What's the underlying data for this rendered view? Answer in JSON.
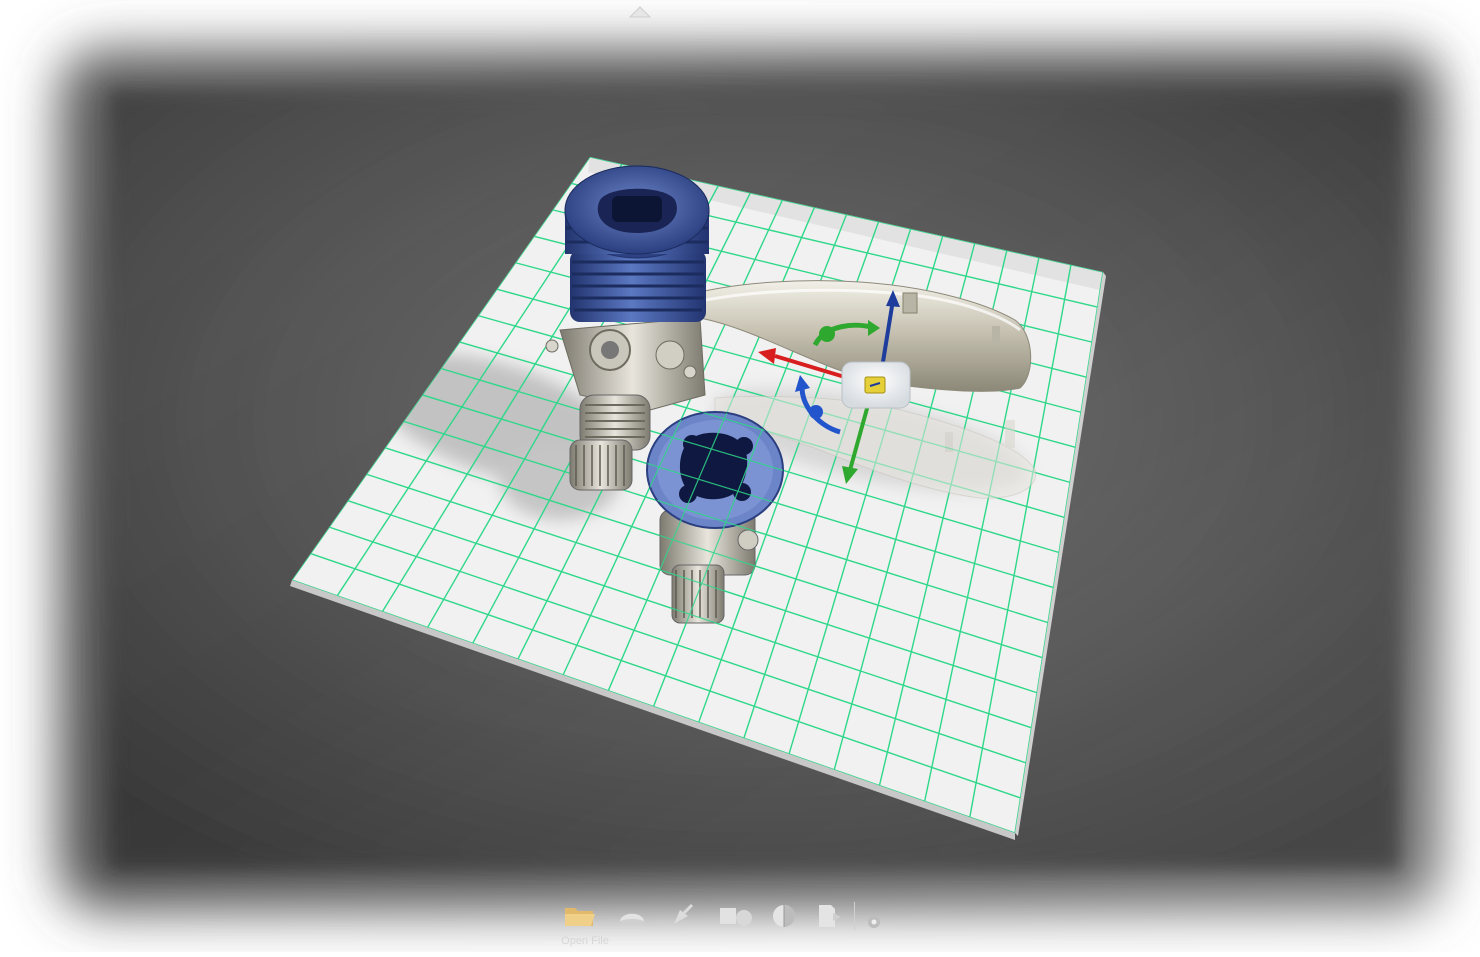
{
  "toolbar": {
    "tooltip": "Open File",
    "buttons": [
      {
        "name": "open-file",
        "icon": "folder-icon"
      },
      {
        "name": "shading",
        "icon": "dome-icon"
      },
      {
        "name": "lighting",
        "icon": "spotlight-icon"
      },
      {
        "name": "objects",
        "icon": "shapes-icon"
      },
      {
        "name": "materials",
        "icon": "sphere-icon"
      },
      {
        "name": "export",
        "icon": "export-icon"
      },
      {
        "name": "settings",
        "icon": "gear-icon"
      }
    ]
  },
  "gizmo": {
    "x_axis_color": "#d81e1e",
    "y_axis_color": "#2ea82e",
    "z_axis_color": "#1e3c9c"
  },
  "colors": {
    "grid_line": "#2ed889",
    "floor": "#f0f0f0",
    "engine_head": "#3f5aa3"
  }
}
